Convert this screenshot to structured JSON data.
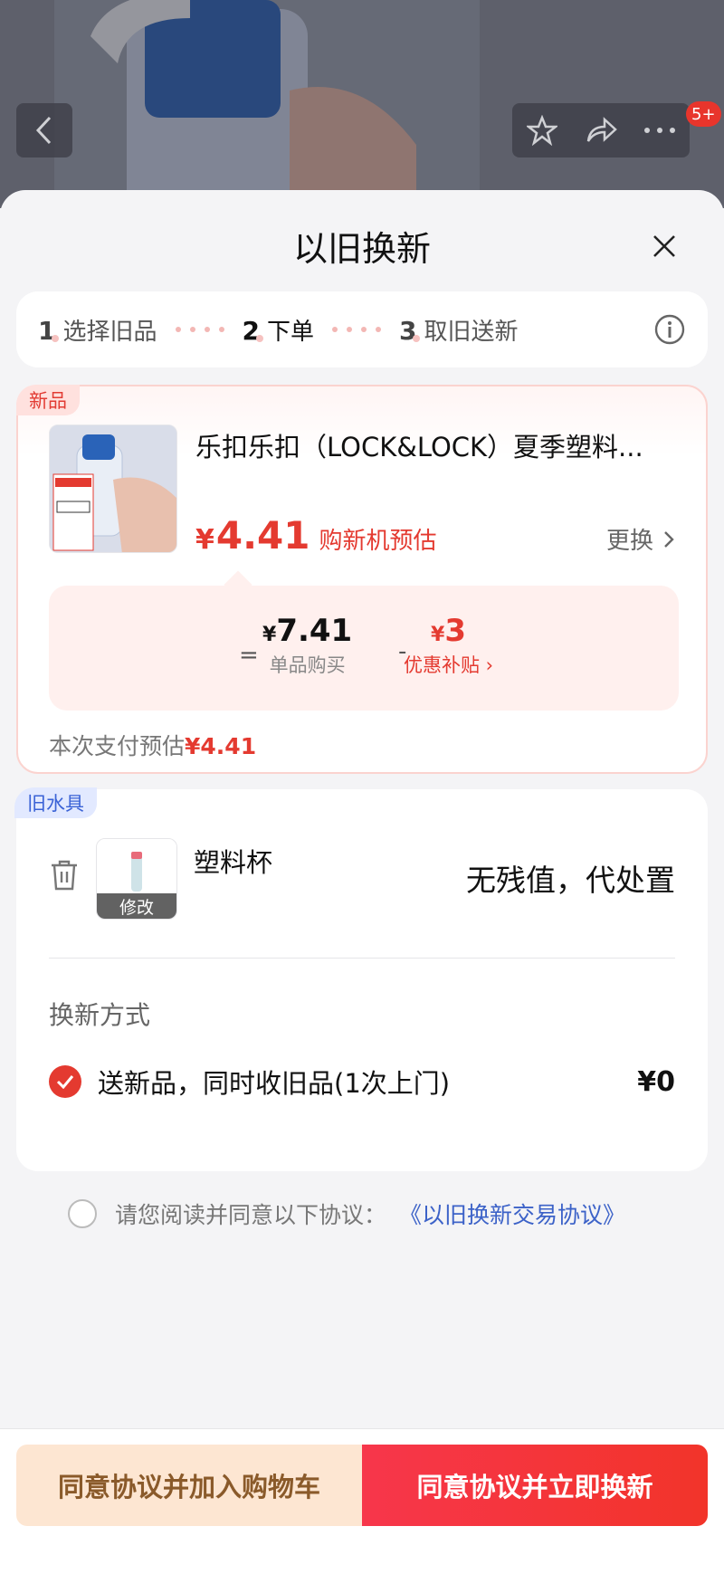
{
  "header": {
    "notification_count": "5+"
  },
  "sheet": {
    "title": "以旧换新"
  },
  "steps": [
    {
      "num": "1",
      "label": "选择旧品"
    },
    {
      "num": "2",
      "label": "下单"
    },
    {
      "num": "3",
      "label": "取旧送新"
    }
  ],
  "new_item": {
    "tag": "新品",
    "title": "乐扣乐扣（LOCK&LOCK）夏季塑料...",
    "price_symbol": "¥",
    "price": "4.41",
    "price_note": "购新机预估",
    "change_label": "更换",
    "calc": {
      "equals": "=",
      "unit_price_symbol": "¥",
      "unit_price": "7.41",
      "unit_price_label": "单品购买",
      "minus": "-",
      "subsidy_symbol": "¥",
      "subsidy": "3",
      "subsidy_label": "优惠补贴 ›"
    },
    "pay_estimate_label": "本次支付预估",
    "pay_estimate_value": "¥4.41"
  },
  "old_item": {
    "tag": "旧水具",
    "name": "塑料杯",
    "edit_label": "修改",
    "value_text": "无残值，代处置",
    "method_title": "换新方式",
    "method_label": "送新品，同时收旧品(1次上门)",
    "method_price": "¥0"
  },
  "agreement": {
    "text": "请您阅读并同意以下协议：",
    "link": "《以旧换新交易协议》"
  },
  "actions": {
    "add_cart": "同意协议并加入购物车",
    "exchange_now": "同意协议并立即换新"
  },
  "colors": {
    "accent_red": "#e43a30",
    "link_blue": "#3c62c8",
    "cart_button_bg": "#fde6d2"
  }
}
